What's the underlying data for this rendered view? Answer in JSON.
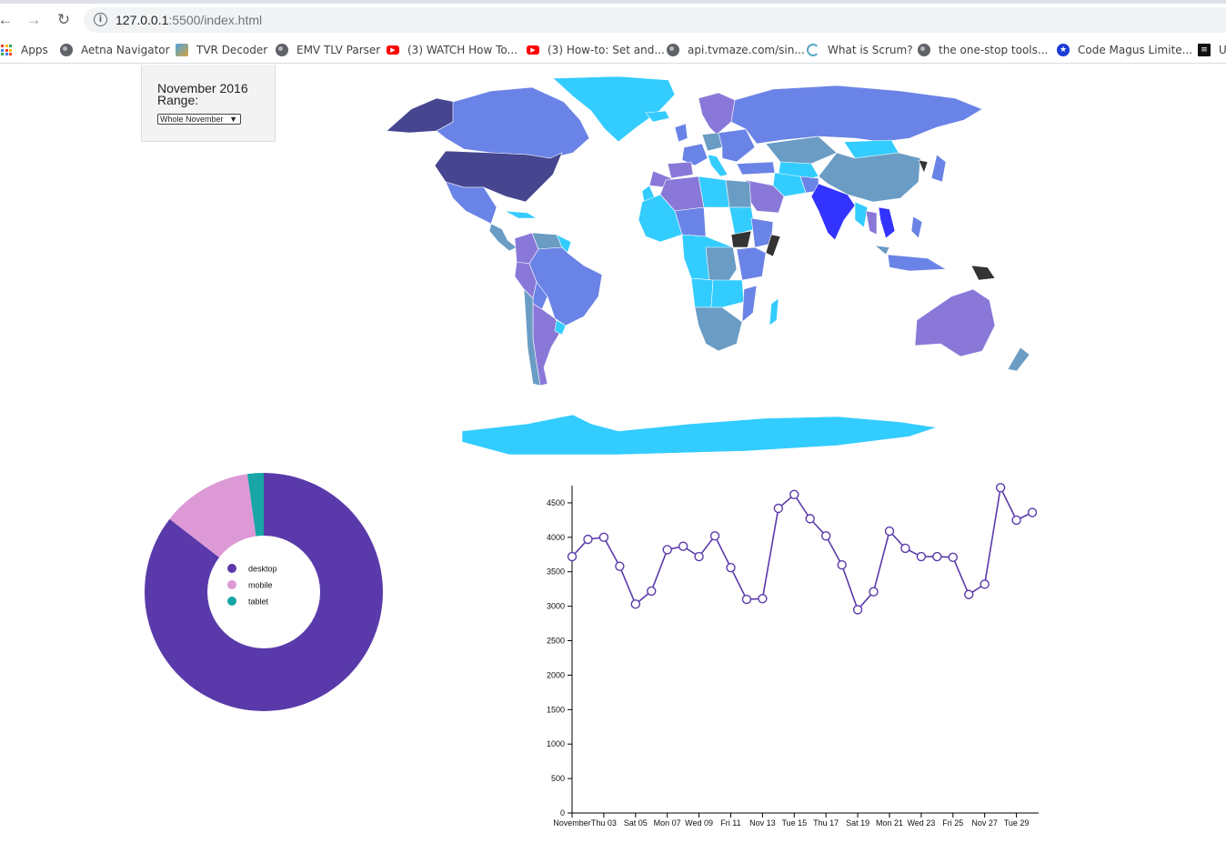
{
  "browser": {
    "url_host": "127.0.0.1",
    "url_rest": ":5500/index.html",
    "bookmarks": [
      {
        "label": "Apps",
        "icon": "apps-icon"
      },
      {
        "label": "Aetna Navigator",
        "icon": "globe-icon"
      },
      {
        "label": "TVR Decoder",
        "icon": "tvr-icon"
      },
      {
        "label": "EMV TLV Parser",
        "icon": "globe-icon"
      },
      {
        "label": "(3) WATCH How To...",
        "icon": "youtube-icon"
      },
      {
        "label": "(3) How-to: Set and...",
        "icon": "youtube-icon"
      },
      {
        "label": "api.tvmaze.com/sin...",
        "icon": "globe-icon"
      },
      {
        "label": "What is Scrum?",
        "icon": "scrum-icon"
      },
      {
        "label": "the one-stop tools...",
        "icon": "globe-icon"
      },
      {
        "label": "Code Magus Limite...",
        "icon": "star-icon"
      },
      {
        "label": "U",
        "icon": "u-icon"
      }
    ]
  },
  "panel": {
    "month": "November 2016",
    "range_label": "Range:",
    "selected_range": "Whole November"
  },
  "map": {
    "palette": {
      "ocean_bg": "#ffffff",
      "cyan": "#33ccff",
      "blue": "#6a83e6",
      "purple": "#8a78d8",
      "slate": "#6a9cc4",
      "navy": "#45468f",
      "bright": "#3333ff",
      "dark": "#333333"
    }
  },
  "donut": {
    "segments": [
      {
        "label": "desktop",
        "value": 85.5,
        "color": "#5a3aaa"
      },
      {
        "label": "mobile",
        "value": 12.3,
        "color": "#dd99d6"
      },
      {
        "label": "tablet",
        "value": 2.2,
        "color": "#17a5a5"
      }
    ]
  },
  "chart_data": {
    "type": "line",
    "x": [
      "2016-11-01",
      "2016-11-02",
      "2016-11-03",
      "2016-11-04",
      "2016-11-05",
      "2016-11-06",
      "2016-11-07",
      "2016-11-08",
      "2016-11-09",
      "2016-11-10",
      "2016-11-11",
      "2016-11-12",
      "2016-11-13",
      "2016-11-14",
      "2016-11-15",
      "2016-11-16",
      "2016-11-17",
      "2016-11-18",
      "2016-11-19",
      "2016-11-20",
      "2016-11-21",
      "2016-11-22",
      "2016-11-23",
      "2016-11-24",
      "2016-11-25",
      "2016-11-26",
      "2016-11-27",
      "2016-11-28",
      "2016-11-29",
      "2016-11-30"
    ],
    "values": [
      3720,
      3970,
      4000,
      3580,
      3030,
      3220,
      3820,
      3870,
      3720,
      4020,
      3560,
      3100,
      3110,
      4420,
      4620,
      4270,
      4020,
      3600,
      2950,
      3210,
      4090,
      3840,
      3720,
      3720,
      3710,
      3170,
      3320,
      4720,
      4250,
      4360
    ],
    "xticks": [
      "November",
      "Thu 03",
      "Sat 05",
      "Mon 07",
      "Wed 09",
      "Fri 11",
      "Nov 13",
      "Tue 15",
      "Thu 17",
      "Sat 19",
      "Mon 21",
      "Wed 23",
      "Fri 25",
      "Nov 27",
      "Tue 29"
    ],
    "yticks": [
      "0",
      "500",
      "1000",
      "1500",
      "2000",
      "2500",
      "3000",
      "3500",
      "4000",
      "4500"
    ],
    "ylim": [
      0,
      4750
    ],
    "title": "",
    "xlabel": "",
    "ylabel": "",
    "line_color": "#5a3aaa"
  }
}
